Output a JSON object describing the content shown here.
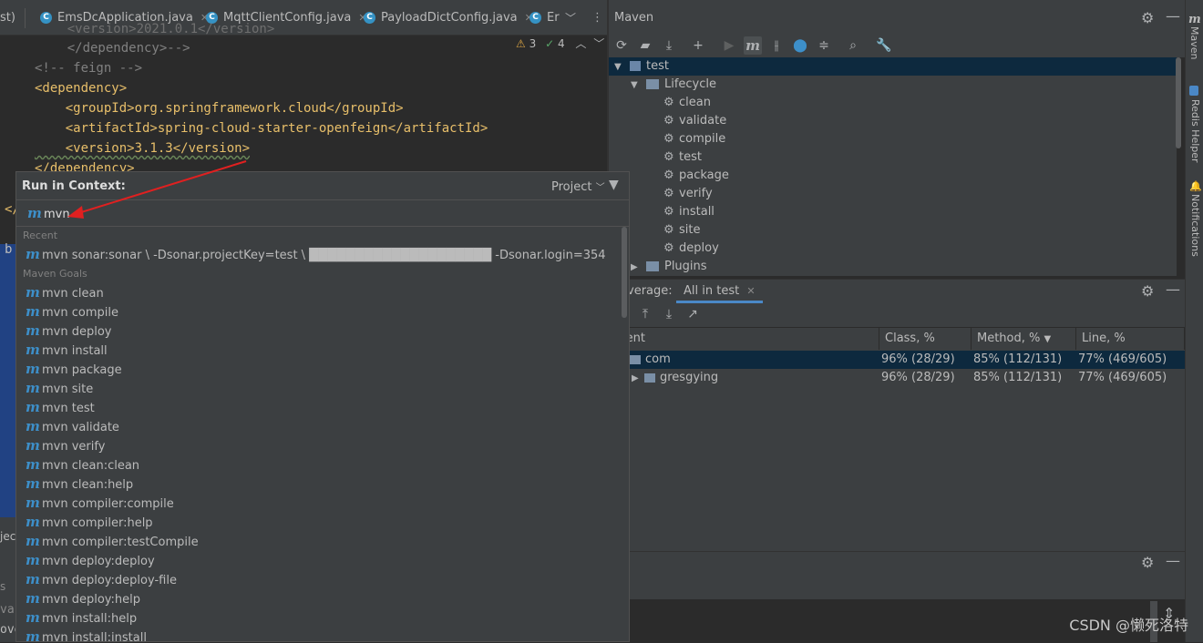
{
  "editor": {
    "tabs": [
      {
        "label": "st)"
      },
      {
        "label": "EmsDcApplication.java"
      },
      {
        "label": "MqttClientConfig.java"
      },
      {
        "label": "PayloadDictConfig.java"
      },
      {
        "label": "Er"
      }
    ],
    "inspections": {
      "warnings": "3",
      "ok": "4"
    },
    "code_lines": [
      "    <version>2021.0.1</version>",
      "    </dependency>-->",
      "<!-- feign -->",
      "<dependency>",
      "    <groupId>org.springframework.cloud</groupId>",
      "    <artifactId>spring-cloud-starter-openfeign</artifactId>",
      "    <version>3.1.3</version>",
      "</dependency>"
    ]
  },
  "popup": {
    "title": "Run in Context:",
    "scope": "Project",
    "input_value": "mvn",
    "recent_label": "Recent",
    "recent_items": [
      {
        "text": "mvn sonar:sonar \\   -Dsonar.projectKey=test \\   ████████████████████   -Dsonar.login=354"
      }
    ],
    "goals_label": "Maven Goals",
    "goals": [
      "mvn clean",
      "mvn compile",
      "mvn deploy",
      "mvn install",
      "mvn package",
      "mvn site",
      "mvn test",
      "mvn validate",
      "mvn verify",
      "mvn clean:clean",
      "mvn clean:help",
      "mvn compiler:compile",
      "mvn compiler:help",
      "mvn compiler:testCompile",
      "mvn deploy:deploy",
      "mvn deploy:deploy-file",
      "mvn deploy:help",
      "mvn install:help",
      "mvn install:install"
    ]
  },
  "maven": {
    "title": "Maven",
    "root": "test",
    "lifecycle_label": "Lifecycle",
    "phases": [
      "clean",
      "validate",
      "compile",
      "test",
      "package",
      "verify",
      "install",
      "site",
      "deploy"
    ],
    "plugins_label": "Plugins"
  },
  "coverage": {
    "label": "verage:",
    "tab": "All in test",
    "columns": [
      "ment",
      "Class, %",
      "Method, %",
      "Line, %"
    ],
    "rows": [
      {
        "name": "com",
        "class": "96% (28/29)",
        "method": "85% (112/131)",
        "line": "77% (469/605)"
      },
      {
        "name": "gresgying",
        "class": "96% (28/29)",
        "method": "85% (112/131)",
        "line": "77% (469/605)"
      }
    ]
  },
  "strip": {
    "maven": "Maven",
    "redis": "Redis Helper",
    "notifications": "Notifications"
  },
  "left_panel": {
    "a": "ject",
    "b": "s",
    "c": "va)",
    "d": "ove"
  },
  "watermark": "CSDN @懒死洛特",
  "colors": {
    "accent": "#3d8fc9",
    "arrow": "#e02020",
    "selection": "#214283"
  }
}
